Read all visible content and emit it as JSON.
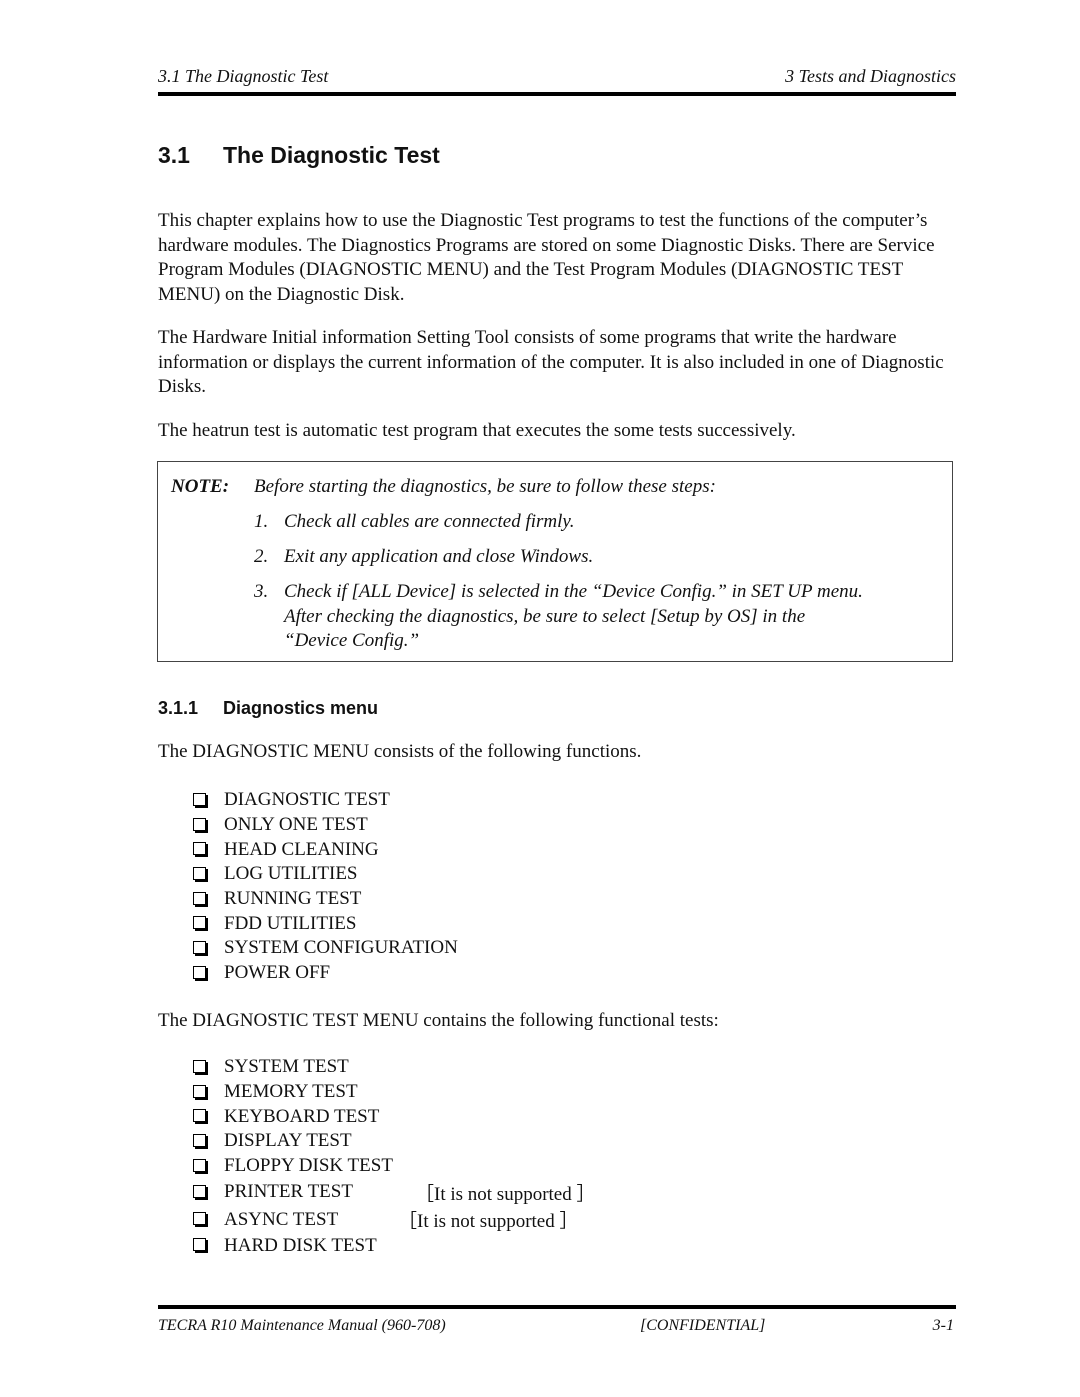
{
  "header": {
    "section": "3.1 The Diagnostic Test",
    "chapter": "3 Tests and Diagnostics"
  },
  "heading": {
    "number": "3.1",
    "title": "The Diagnostic Test"
  },
  "paragraphs": [
    "This chapter explains how to use the Diagnostic Test programs to test the functions of the computer’s hardware modules. The Diagnostics Programs are stored on some Diagnostic Disks. There are Service Program Modules (DIAGNOSTIC MENU) and the Test Program Modules (DIAGNOSTIC TEST MENU) on the Diagnostic Disk.",
    "The Hardware Initial information Setting Tool consists of some programs that write the hardware information or displays the current information of the computer. It is also included in one of Diagnostic Disks.",
    "The heatrun test is automatic test program that executes the some tests successively."
  ],
  "note": {
    "label": "NOTE:",
    "intro": "Before starting the diagnostics, be sure to follow these steps:",
    "steps": [
      {
        "num": "1.",
        "text": "Check all cables are connected firmly."
      },
      {
        "num": "2.",
        "text": "Exit any application and close Windows."
      },
      {
        "num": "3.",
        "lines": [
          "Check if [ALL Device] is selected in the “Device Config.” in SET UP menu.",
          "After checking the diagnostics, be sure to select [Setup by OS] in the",
          "“Device Config.”"
        ]
      }
    ]
  },
  "subheading": {
    "number": "3.1.1",
    "title": "Diagnostics menu"
  },
  "diagnostic_menu": {
    "intro": "The DIAGNOSTIC MENU consists of the following functions.",
    "items": [
      "DIAGNOSTIC TEST",
      "ONLY ONE TEST",
      "HEAD CLEANING",
      "LOG UTILITIES",
      "RUNNING TEST",
      "FDD UTILITIES",
      "SYSTEM CONFIGURATION",
      "POWER OFF"
    ]
  },
  "test_menu": {
    "intro": "The DIAGNOSTIC TEST MENU contains the following functional tests:",
    "items": [
      {
        "label": "SYSTEM TEST"
      },
      {
        "label": "MEMORY TEST"
      },
      {
        "label": "KEYBOARD TEST"
      },
      {
        "label": "DISPLAY TEST"
      },
      {
        "label": "FLOPPY DISK TEST"
      },
      {
        "label": "PRINTER TEST",
        "note": "［It is not supported ］"
      },
      {
        "label": "ASYNC TEST",
        "note": "［It is not supported ］"
      },
      {
        "label": "HARD DISK TEST"
      }
    ]
  },
  "footer": {
    "manual": "TECRA R10 Maintenance Manual (960-708)",
    "classification": "[CONFIDENTIAL]",
    "page": "3-1"
  }
}
